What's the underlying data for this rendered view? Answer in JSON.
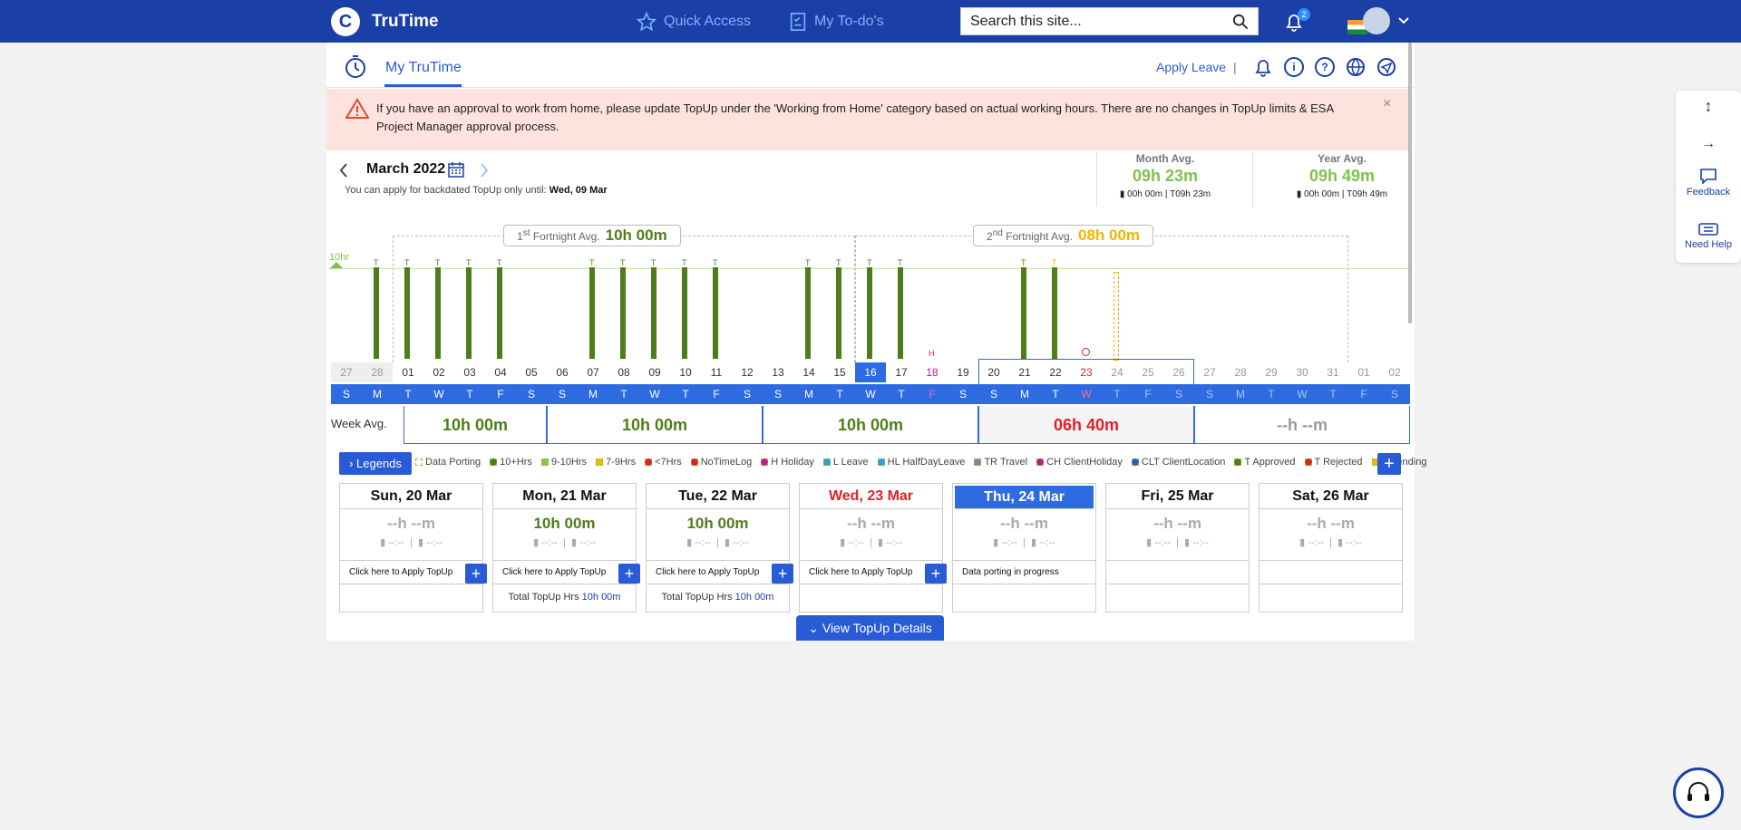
{
  "header": {
    "logo_letter": "C",
    "brand": "TruTime",
    "quick_access": "Quick Access",
    "todos": "My To-do's",
    "search_placeholder": "Search this site...",
    "notification_count": "2"
  },
  "subheader": {
    "tab": "My TruTime",
    "apply_leave": "Apply Leave",
    "separator": "|"
  },
  "alert": {
    "text": "If you have an approval to work from home, please update TopUp under the 'Working from Home' category based on actual working hours. There are no changes in TopUp limits & ESA Project Manager approval process.",
    "close": "×"
  },
  "calendar": {
    "month": "March 2022",
    "backdated_text": "You can apply for backdated TopUp only until:",
    "backdated_date": "Wed, 09 Mar",
    "threshold_label": "10hr"
  },
  "month_avg": {
    "label": "Month Avg.",
    "value": "09h 23m",
    "in": "00h 00m",
    "t_prefix": "T",
    "total": "09h 23m"
  },
  "year_avg": {
    "label": "Year Avg.",
    "value": "09h 49m",
    "in": "00h 00m",
    "t_prefix": "T",
    "total": "09h 49m"
  },
  "fortnights": [
    {
      "label_pre": "1",
      "label_sup": "st",
      "label_post": "Fortnight Avg.",
      "value": "10h 00m",
      "color": "#4f7d1a"
    },
    {
      "label_pre": "2",
      "label_sup": "nd",
      "label_post": "Fortnight Avg.",
      "value": "08h 00m",
      "color": "#f4b400"
    }
  ],
  "days": [
    "27",
    "28",
    "01",
    "02",
    "03",
    "04",
    "05",
    "06",
    "07",
    "08",
    "09",
    "10",
    "11",
    "12",
    "13",
    "14",
    "15",
    "16",
    "17",
    "18",
    "19",
    "20",
    "21",
    "22",
    "23",
    "24",
    "25",
    "26",
    "27",
    "28",
    "29",
    "30",
    "31",
    "01",
    "02"
  ],
  "dows": [
    "S",
    "M",
    "T",
    "W",
    "T",
    "F",
    "S",
    "S",
    "M",
    "T",
    "W",
    "T",
    "F",
    "S",
    "S",
    "M",
    "T",
    "W",
    "T",
    "F",
    "S",
    "S",
    "M",
    "T",
    "W",
    "T",
    "F",
    "S",
    "S",
    "M",
    "T",
    "W",
    "T",
    "F",
    "S"
  ],
  "bar_days": [
    1,
    2,
    3,
    4,
    5,
    8,
    9,
    10,
    11,
    12,
    15,
    16,
    17,
    18,
    22,
    23
  ],
  "bar_marks": [
    "T",
    "T",
    "T",
    "T",
    "T",
    "T",
    "T",
    "T",
    "T",
    "T",
    "T",
    "T",
    "T",
    "T",
    "T",
    "T"
  ],
  "holiday_mark": "H",
  "week_avg": {
    "label": "Week Avg.",
    "values": [
      "10h 00m",
      "10h 00m",
      "10h 00m",
      "06h 40m",
      "--h --m"
    ]
  },
  "legends": {
    "button": "Legends",
    "items": [
      {
        "label": "Data Porting",
        "color": "#ffffff"
      },
      {
        "label": "10+Hrs",
        "color": "#4f7d1a"
      },
      {
        "label": "9-10Hrs",
        "color": "#8cc63f"
      },
      {
        "label": "7-9Hrs",
        "color": "#f4b400"
      },
      {
        "label": "<7Hrs",
        "color": "#e0202a"
      },
      {
        "label": "NoTimeLog",
        "color": "#e0202a"
      },
      {
        "label": "H Holiday",
        "color": "#c2188e"
      },
      {
        "label": "L Leave",
        "color": "#2f9be0"
      },
      {
        "label": "HL HalfDayLeave",
        "color": "#2f9be0"
      },
      {
        "label": "TR Travel",
        "color": "#888888"
      },
      {
        "label": "CH ClientHoliday",
        "color": "#c2188e"
      },
      {
        "label": "CLT ClientLocation",
        "color": "#2a5bd7"
      },
      {
        "label": "T Approved",
        "color": "#4f7d1a"
      },
      {
        "label": "T Rejected",
        "color": "#e0202a"
      },
      {
        "label": "T Pending",
        "color": "#f4b400"
      }
    ]
  },
  "cards": [
    {
      "date": "Sun, 20 Mar",
      "hours": "--h --m",
      "in": "--:--",
      "out": "--:--",
      "action": "Click here to Apply TopUp",
      "total_label": "",
      "total": ""
    },
    {
      "date": "Mon, 21 Mar",
      "hours": "10h 00m",
      "in": "--:--",
      "out": "--:--",
      "action": "Click here to Apply TopUp",
      "total_label": "Total TopUp Hrs",
      "total": "10h 00m"
    },
    {
      "date": "Tue, 22 Mar",
      "hours": "10h 00m",
      "in": "--:--",
      "out": "--:--",
      "action": "Click here to Apply TopUp",
      "total_label": "Total TopUp Hrs",
      "total": "10h 00m"
    },
    {
      "date": "Wed, 23 Mar",
      "hours": "--h --m",
      "in": "--:--",
      "out": "--:--",
      "action": "Click here to Apply TopUp",
      "total_label": "",
      "total": ""
    },
    {
      "date": "Thu, 24 Mar",
      "hours": "--h --m",
      "in": "--:--",
      "out": "--:--",
      "action": "Data porting in progress",
      "total_label": "",
      "total": ""
    },
    {
      "date": "Fri, 25 Mar",
      "hours": "--h --m",
      "in": "--:--",
      "out": "--:--",
      "action": "",
      "total_label": "",
      "total": ""
    },
    {
      "date": "Sat, 26 Mar",
      "hours": "--h --m",
      "in": "--:--",
      "out": "--:--",
      "action": "",
      "total_label": "",
      "total": ""
    }
  ],
  "view_topup": "View TopUp Details",
  "side_panel": {
    "feedback": "Feedback",
    "need_help": "Need Help"
  }
}
